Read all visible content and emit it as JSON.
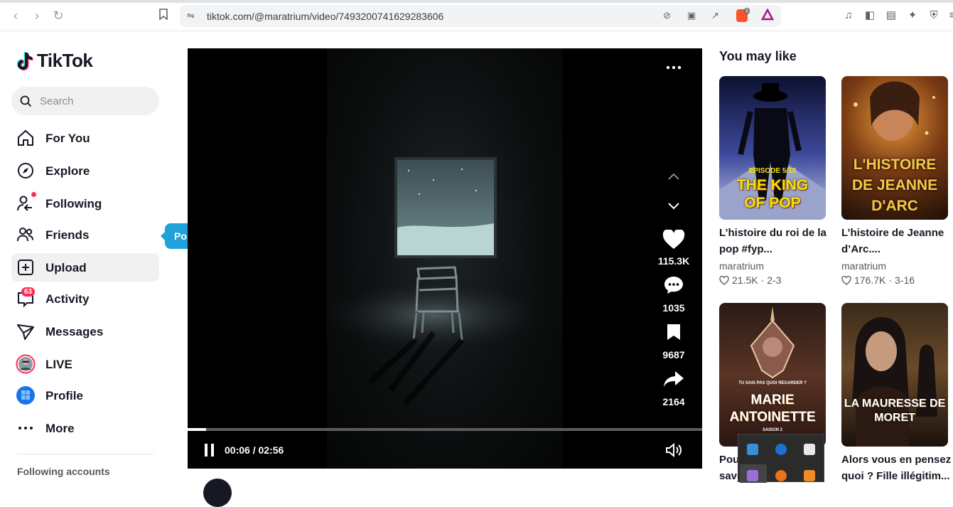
{
  "browser": {
    "url": "tiktok.com/@maratrium/video/7493200741629283606",
    "brave_badge": "6"
  },
  "sidebar": {
    "logo": "TikTok",
    "search_placeholder": "Search",
    "items": [
      {
        "label": "For You"
      },
      {
        "label": "Explore"
      },
      {
        "label": "Following"
      },
      {
        "label": "Friends"
      },
      {
        "label": "Upload"
      },
      {
        "label": "Activity",
        "badge": "63"
      },
      {
        "label": "Messages"
      },
      {
        "label": "LIVE"
      },
      {
        "label": "Profile"
      },
      {
        "label": "More"
      }
    ],
    "tooltip": "Post video",
    "following_title": "Following accounts"
  },
  "player": {
    "likes": "115.3K",
    "comments": "1035",
    "saves": "9687",
    "shares": "2164",
    "time": "00:06 / 02:56",
    "progress": 0.036
  },
  "recommendations": {
    "title": "You may like",
    "cards": [
      {
        "title": "L’histoire du roi de la pop #fyp...",
        "author": "maratrium",
        "likes": "21.5K",
        "date": "2-3",
        "thumb_text": "THE KING OF POP",
        "thumb_sub": "EPISODE 5/10"
      },
      {
        "title": "L’histoire de Jeanne d’Arc....",
        "author": "maratrium",
        "likes": "176.7K",
        "date": "3-16",
        "thumb_text": "L'HISTOIRE DE JEANNE D'ARC"
      },
      {
        "title": "Pou",
        "title2": "save",
        "thumb_text": "MARIE ANTOINETTE",
        "thumb_sub": "TU SAIS PAS QUOI REGARDER ?",
        "thumb_sub2": "SAISON 2"
      },
      {
        "title": "Alors vous en pensez quoi ? Fille illégitim...",
        "thumb_text": "LA MAURESSE DE MORET"
      }
    ]
  },
  "colors": {
    "accent": "#fe2c55",
    "tooltip": "#1fa2d9"
  }
}
